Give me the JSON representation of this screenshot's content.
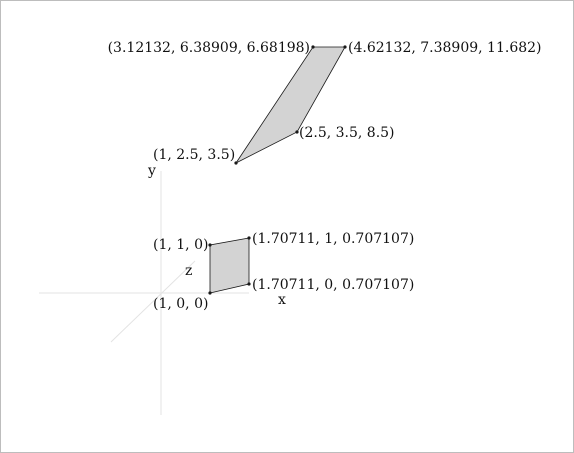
{
  "axes": {
    "x_label": "x",
    "y_label": "y",
    "z_label": "z"
  },
  "shapes": {
    "square": {
      "vertices": [
        {
          "label": "(1, 0, 0)"
        },
        {
          "label": "(1.70711, 0, 0.707107)"
        },
        {
          "label": "(1.70711, 1, 0.707107)"
        },
        {
          "label": "(1, 1, 0)"
        }
      ]
    },
    "parallelogram": {
      "vertices": [
        {
          "label": "(1, 2.5, 3.5)"
        },
        {
          "label": "(2.5, 3.5, 8.5)"
        },
        {
          "label": "(4.62132, 7.38909, 11.682)"
        },
        {
          "label": "(3.12132, 6.38909, 6.68198)"
        }
      ]
    }
  },
  "colors": {
    "fill": "#d3d3d3",
    "stroke": "#1a1a1a",
    "axis": "#e3e3e3"
  }
}
